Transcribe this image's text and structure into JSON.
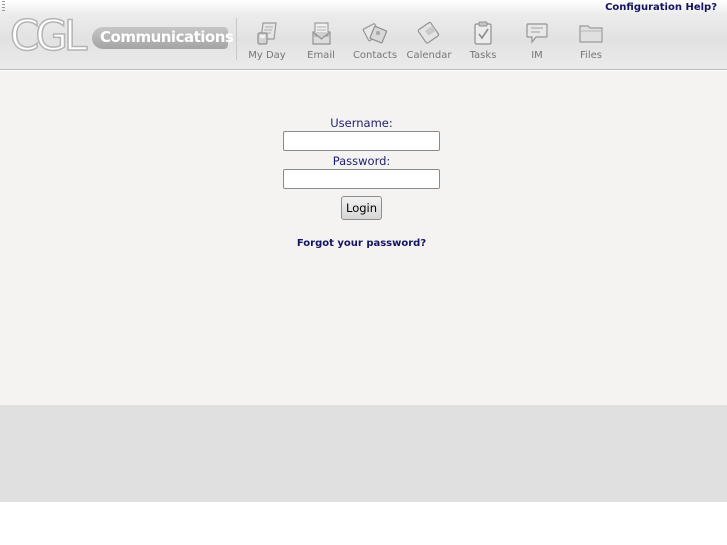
{
  "header": {
    "config_help": "Configuration Help?",
    "logo_letters": "CGL",
    "logo_word": "Communications"
  },
  "nav": {
    "items": [
      {
        "label": "My Day",
        "icon": "my-day-icon"
      },
      {
        "label": "Email",
        "icon": "email-icon"
      },
      {
        "label": "Contacts",
        "icon": "contacts-icon"
      },
      {
        "label": "Calendar",
        "icon": "calendar-icon"
      },
      {
        "label": "Tasks",
        "icon": "tasks-icon"
      },
      {
        "label": "IM",
        "icon": "im-icon"
      },
      {
        "label": "Files",
        "icon": "files-icon"
      }
    ]
  },
  "login": {
    "username_label": "Username:",
    "username_value": "",
    "password_label": "Password:",
    "password_value": "",
    "login_button": "Login",
    "forgot_link": "Forgot your password?"
  },
  "colors": {
    "link": "#141460",
    "label": "#1f1f70",
    "content_bg": "#f4f3f2",
    "footer_bg": "#e1e0e0"
  }
}
